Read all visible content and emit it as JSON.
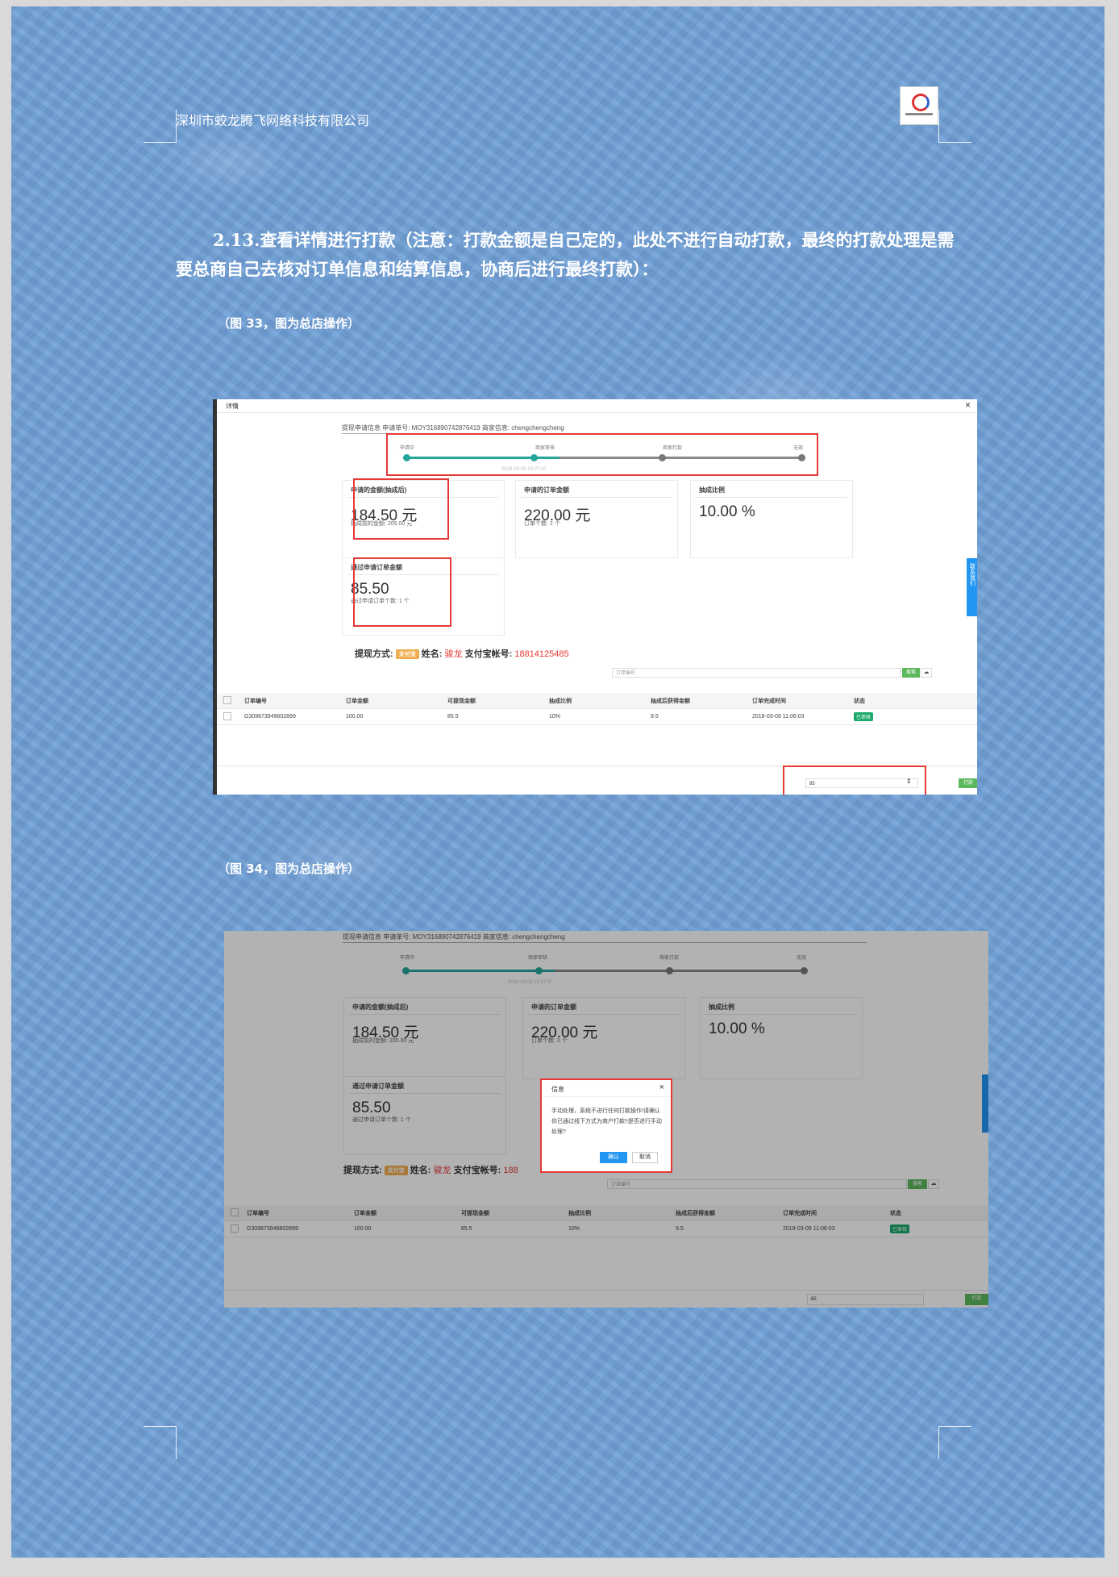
{
  "header": {
    "company": "深圳市蛟龙腾飞网络科技有限公司"
  },
  "section": {
    "number": "2.13.",
    "title": "查看详情进行打款（注意：打款金额是自己定的，此处不进行自动打款，最终的打款处理是需要总商自己去核对订单信息和结算信息，协商后进行最终打款）："
  },
  "captions": {
    "fig33": "（图 33，图为总店操作）",
    "fig34": "（图 34，图为总店操作）"
  },
  "shot1": {
    "dialog_title": "详情",
    "close": "×",
    "info_line": "提现申请信息  申请单号: MOY316890742876419  商家信息: chengchengcheng",
    "steps": [
      "申请中",
      "商家审核",
      "商家打款",
      "无效"
    ],
    "step_time": "2018-03-09 10:27:47",
    "cards": [
      {
        "title": "申请的金额(抽成后)",
        "value": "184.50 元",
        "sub": "抽成前的金额: 205.00 元"
      },
      {
        "title": "申请的订单金额",
        "value": "220.00 元",
        "sub": "订单个数: 2 个"
      },
      {
        "title": "抽成比例",
        "value": "10.00 %",
        "sub": ""
      },
      {
        "title": "通过申请订单金额",
        "value": "85.50",
        "sub": "通过申请订单个数: 1 个"
      }
    ],
    "payment": {
      "method_label": "提现方式:",
      "method": "支付宝",
      "name_label": "姓名:",
      "name": "骏龙",
      "account_label": "支付宝帐号:",
      "account": "18814125485"
    },
    "search": {
      "placeholder": "订单编号",
      "button": "搜索",
      "cloud_icon": "cloud-icon"
    },
    "table": {
      "headers": [
        "订单编号",
        "订单金额",
        "可提现金额",
        "抽成比例",
        "抽成后获得金额",
        "订单完成时间",
        "状态"
      ],
      "rows": [
        [
          "G309873949602899",
          "100.00",
          "85.5",
          "10%",
          "9.5",
          "2018-03-09 11:06:03",
          "已审核"
        ]
      ]
    },
    "pay_input": "85",
    "pay_button": "打款",
    "sidetab": "联系我们"
  },
  "shot2": {
    "info_line": "提现申请信息  申请单号: MOY316890742876419  商家信息: chengchengcheng",
    "dialog": {
      "title": "信息",
      "close": "×",
      "message": "手动处理，系统不进行任何打款操作!请确认你已通过线下方式为商户打款!!是否进行手动处理?",
      "ok": "确认",
      "cancel": "取消"
    },
    "payment_account_partial": "188",
    "pay_input": "85",
    "pay_button": "打款"
  },
  "colors": {
    "accent": "#e53935",
    "step_done": "#26a69a",
    "badge": "#1aa86b",
    "pay_button": "#5cb85c"
  }
}
